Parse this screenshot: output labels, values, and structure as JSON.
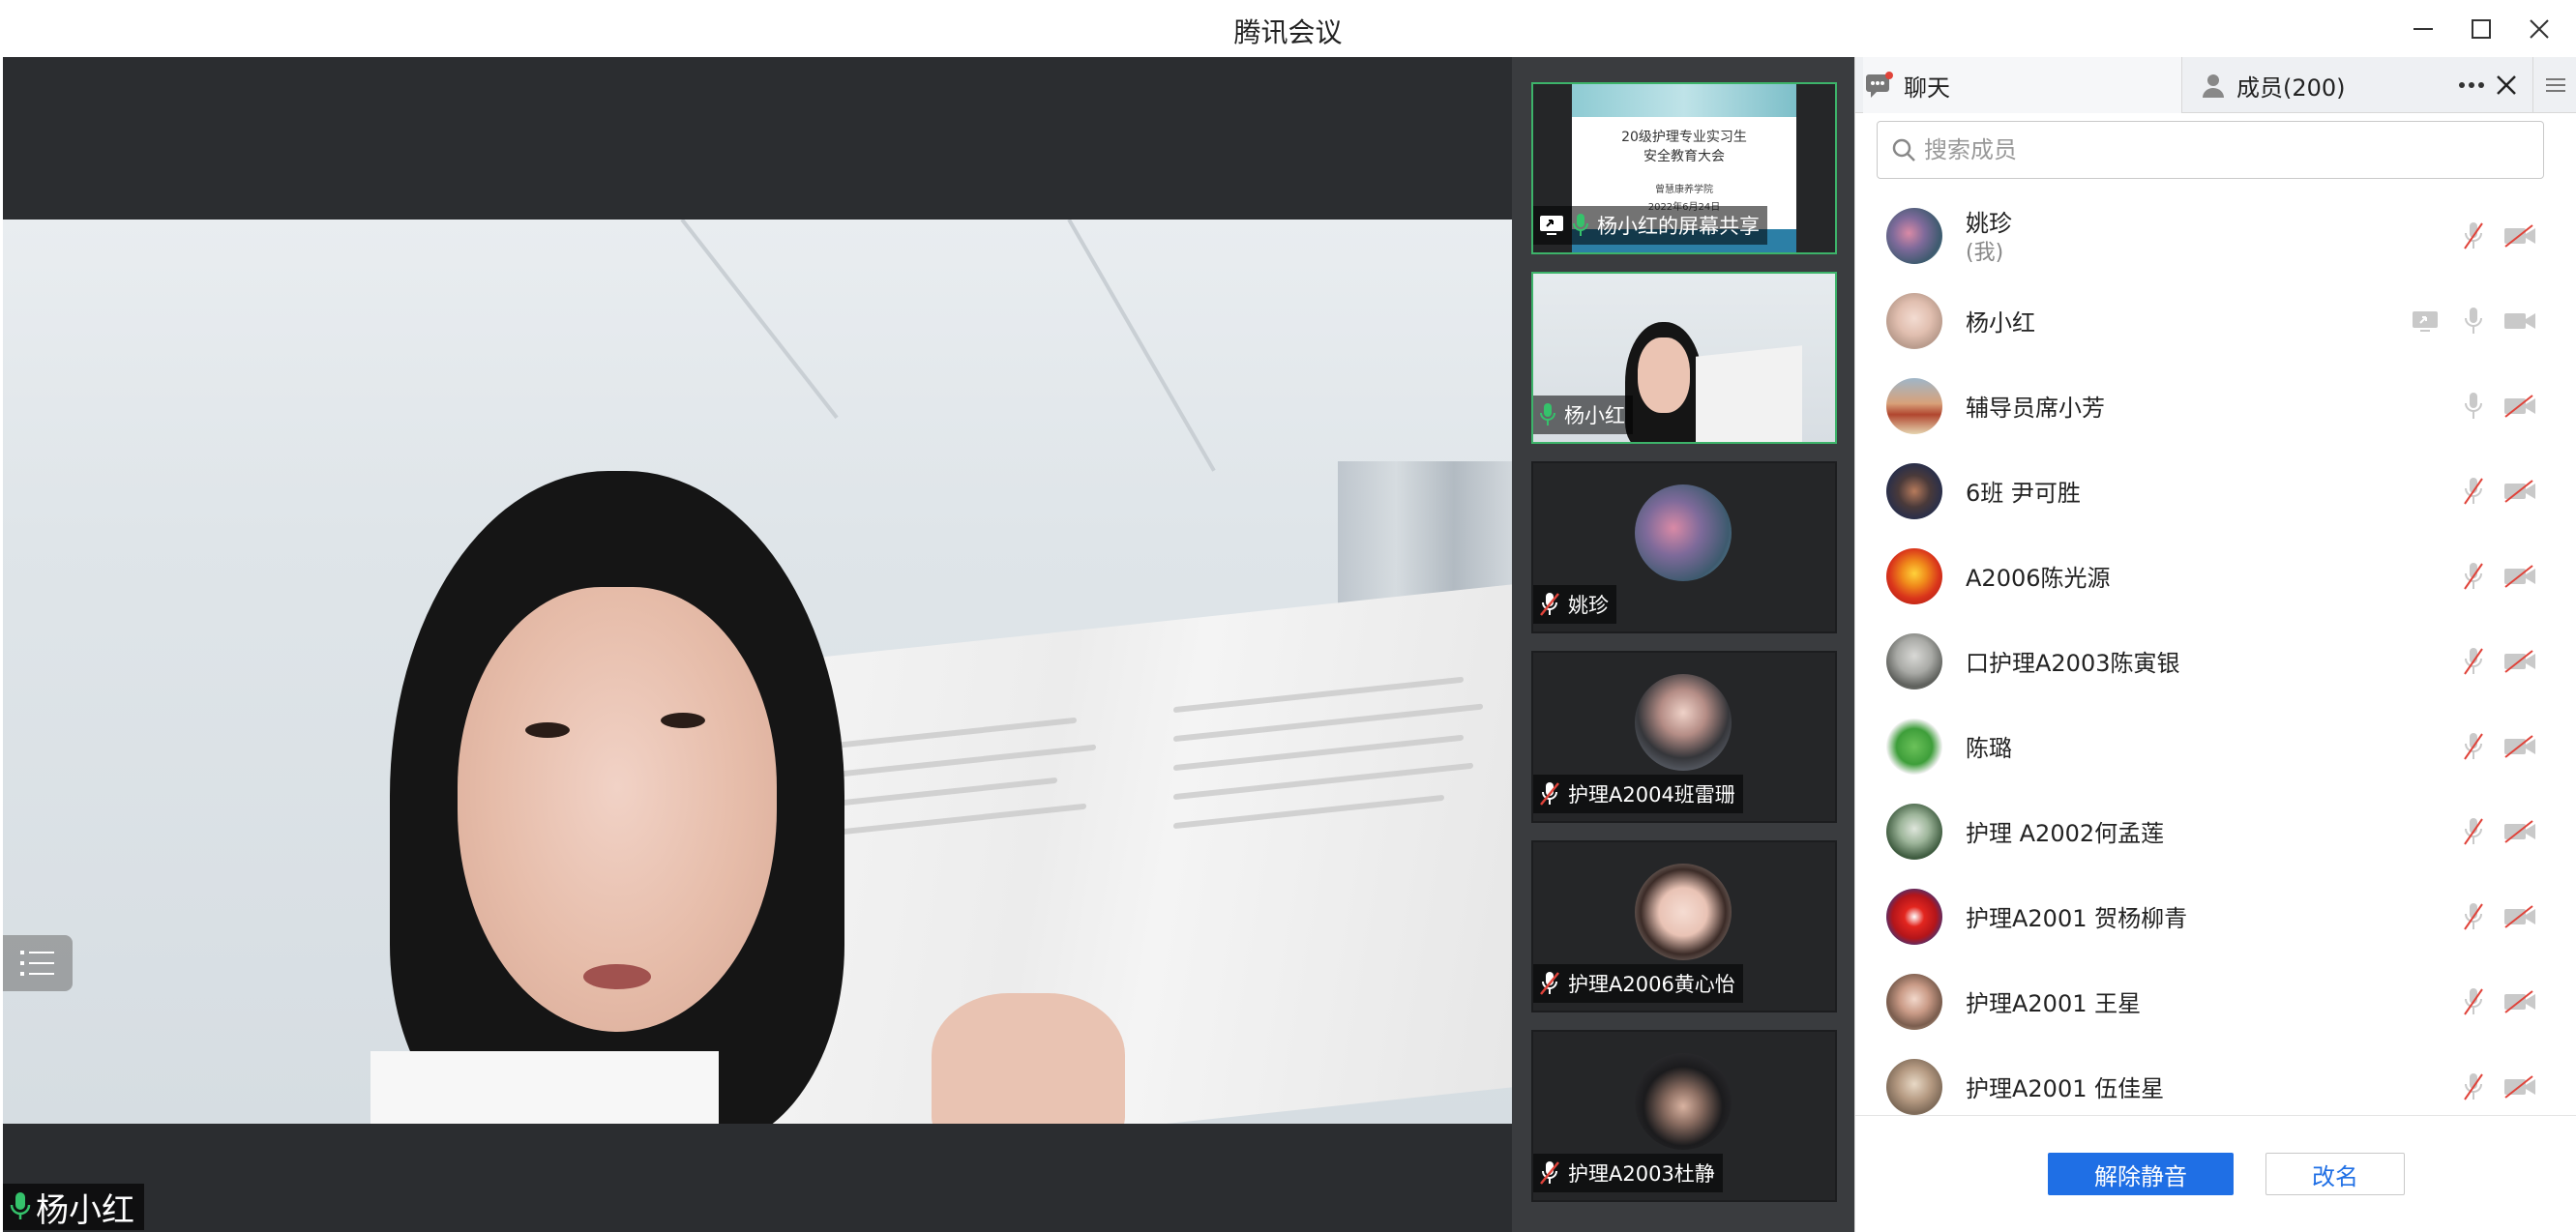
{
  "window": {
    "title": "腾讯会议"
  },
  "main_video": {
    "speaker_name": "杨小红"
  },
  "thumbnails": [
    {
      "label": "杨小红的屏幕共享",
      "type": "screen-share",
      "active": true,
      "slide": {
        "line1": "20级护理专业实习生",
        "line2": "安全教育大会",
        "line3": "曾慧康养学院",
        "line4": "2022年6月24日"
      }
    },
    {
      "label": "杨小红",
      "type": "video",
      "active": true
    },
    {
      "label": "姚珍",
      "type": "avatar",
      "muted": true
    },
    {
      "label": "护理A2004班雷珊",
      "type": "avatar",
      "muted": true
    },
    {
      "label": "护理A2006黄心怡",
      "type": "avatar",
      "muted": true
    },
    {
      "label": "护理A2003杜静",
      "type": "avatar",
      "muted": true
    }
  ],
  "panel": {
    "chat_tab": "聊天",
    "members_tab": "成员(200)",
    "search_placeholder": "搜索成员",
    "unmute_button": "解除静音",
    "rename_button": "改名",
    "members": [
      {
        "name": "姚珍",
        "sub": "(我)",
        "mic": "muted",
        "cam": "off"
      },
      {
        "name": "杨小红",
        "sub": "",
        "screen": true,
        "mic": "on",
        "cam": "on"
      },
      {
        "name": "辅导员席小芳",
        "sub": "",
        "mic": "on",
        "cam": "off"
      },
      {
        "name": "6班 尹可胜",
        "sub": "",
        "mic": "muted",
        "cam": "off"
      },
      {
        "name": "A2006陈光源",
        "sub": "",
        "mic": "muted",
        "cam": "off"
      },
      {
        "name": "口护理A2003陈寅银",
        "sub": "",
        "mic": "muted",
        "cam": "off"
      },
      {
        "name": "陈璐",
        "sub": "",
        "mic": "muted",
        "cam": "off"
      },
      {
        "name": "护理 A2002何孟莲",
        "sub": "",
        "mic": "muted",
        "cam": "off"
      },
      {
        "name": "护理A2001 贺杨柳青",
        "sub": "",
        "mic": "muted",
        "cam": "off"
      },
      {
        "name": "护理A2001 王星",
        "sub": "",
        "mic": "muted",
        "cam": "off"
      },
      {
        "name": "护理A2001 伍佳星",
        "sub": "",
        "mic": "muted",
        "cam": "off"
      }
    ]
  },
  "colors": {
    "accent": "#1f6fe5",
    "active_border": "#3db36a",
    "mic_on": "#35c26b",
    "muted": "#e0433a"
  }
}
